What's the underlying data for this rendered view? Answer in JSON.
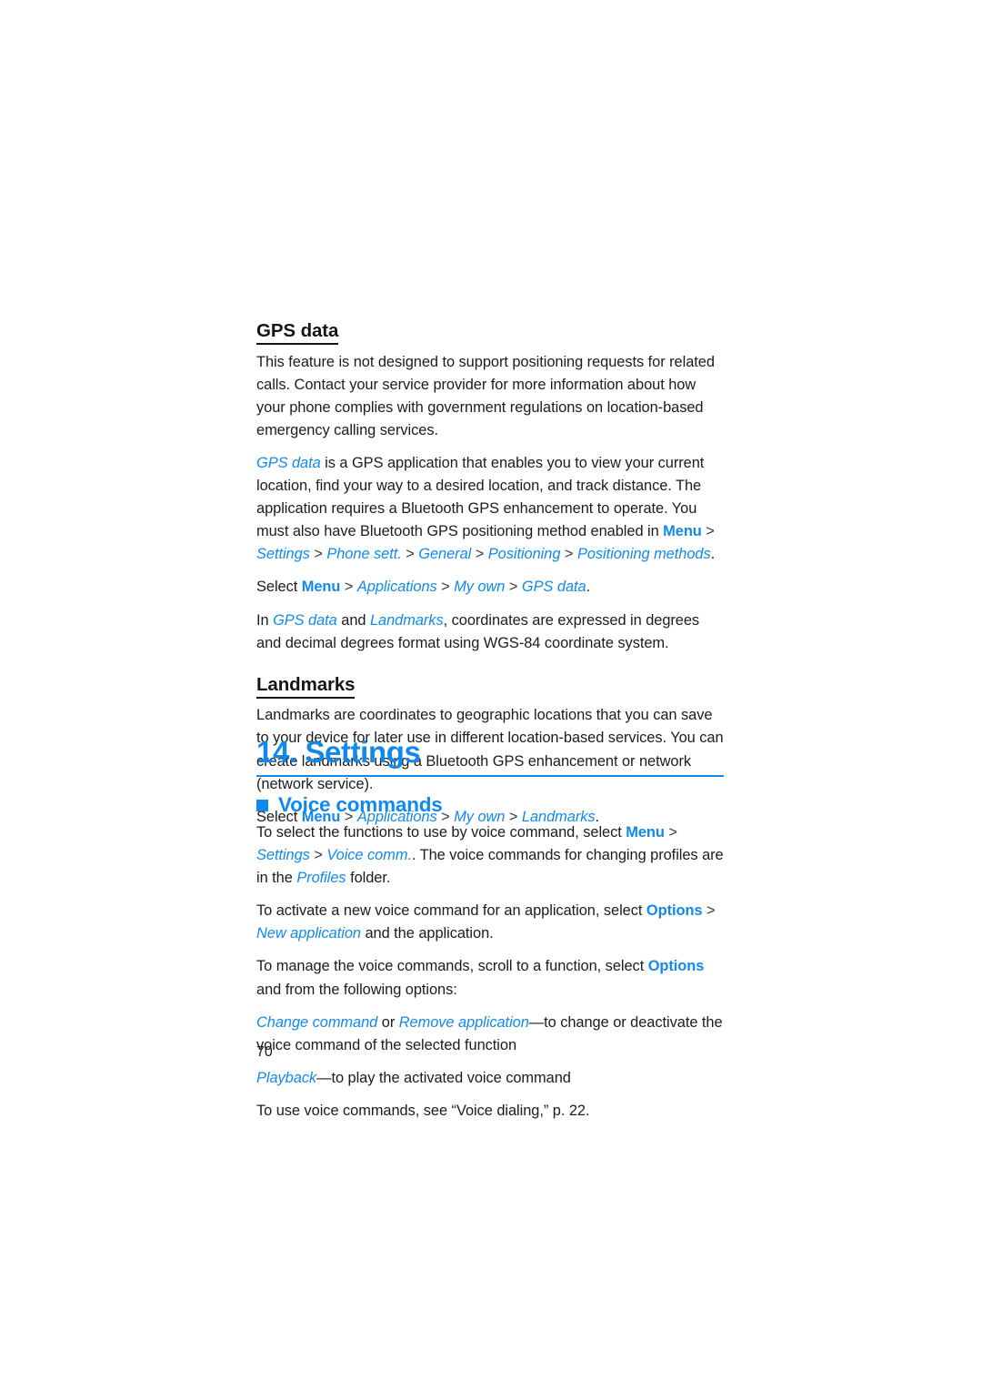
{
  "document": {
    "page_number": "70",
    "accent_color": "#1189ec",
    "text_color": "#1c1c1c"
  },
  "gps_data_section": {
    "heading": "GPS data",
    "p1": "This feature is not designed to support positioning requests for related calls. Contact your service provider for more information about how your phone complies with government regulations on location-based emergency calling services.",
    "p2": {
      "ref_gps_data": "GPS data",
      "text_a": " is a GPS application that enables you to view your current location, find your way to a desired location, and track distance. The application requires a Bluetooth GPS enhancement to operate. You must also have Bluetooth GPS positioning method enabled in ",
      "key_menu": "Menu",
      "sep": ">",
      "item_settings": "Settings",
      "item_phone_sett": "Phone sett.",
      "item_general": "General",
      "item_positioning": "Positioning",
      "item_positioning_methods": "Positioning methods",
      "period": "."
    },
    "p3": {
      "lead": "Select ",
      "key_menu": "Menu",
      "sep": ">",
      "item_applications": "Applications",
      "item_my_own": "My own",
      "item_gps_data": "GPS data",
      "period": "."
    },
    "p4": {
      "lead": "In ",
      "ref_gps_data": "GPS data",
      "mid": " and ",
      "ref_landmarks": "Landmarks",
      "tail": ", coordinates are expressed in degrees and decimal degrees format using WGS-84 coordinate system."
    }
  },
  "landmarks_section": {
    "heading": "Landmarks",
    "p1": "Landmarks are coordinates to geographic locations that you can save to your device for later use in different location-based services. You can create landmarks using a Bluetooth GPS enhancement or network (network service).",
    "p2": {
      "lead": "Select ",
      "key_menu": "Menu",
      "sep": ">",
      "item_applications": "Applications",
      "item_my_own": "My own",
      "item_landmarks": "Landmarks",
      "period": "."
    }
  },
  "chapter": {
    "title": "14. Settings"
  },
  "voice_commands_section": {
    "heading": "Voice commands",
    "p1": {
      "lead": "To select the functions to use by voice command, select ",
      "key_menu": "Menu",
      "sep": ">",
      "item_settings": "Settings",
      "item_voice_comm": "Voice comm.",
      "tail": ". The voice commands for changing profiles are in the ",
      "item_profiles": "Profiles",
      "tail2": " folder."
    },
    "p2": {
      "lead": "To activate a new voice command for an application, select ",
      "key_options": "Options",
      "sep": ">",
      "item_new_application": "New application",
      "tail": " and the application."
    },
    "p3": {
      "lead": "To manage the voice commands, scroll to a function, select ",
      "key_options": "Options",
      "tail": " and from the following options:"
    },
    "p4": {
      "item_change_command": "Change command",
      "mid": " or ",
      "item_remove_application": "Remove application",
      "tail": "—to change or deactivate the voice command of the selected function"
    },
    "p5": {
      "item_playback": "Playback",
      "tail": "—to play the activated voice command"
    },
    "p6": "To use voice commands, see “Voice dialing,” p. 22."
  }
}
